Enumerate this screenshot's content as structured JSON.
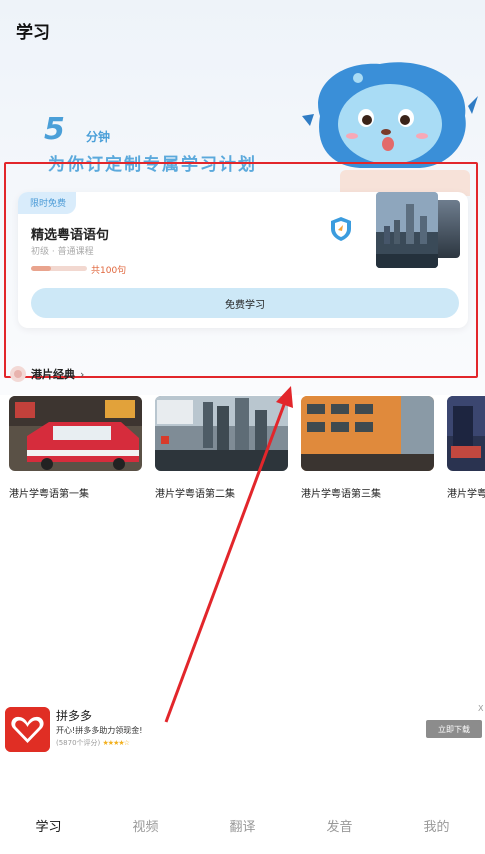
{
  "page": {
    "title": "学习"
  },
  "promo": {
    "number": "5",
    "unit": "分钟",
    "text": "为你订定制专属学习计划"
  },
  "course_card": {
    "badge": "限时免费",
    "title": "精选粤语语句",
    "subtitle": "初级 · 普通课程",
    "progress_fraction": 0.35,
    "count_label": "共100句",
    "button_label": "免费学习"
  },
  "section": {
    "title": "港片经典",
    "arrow": "›"
  },
  "videos": [
    {
      "label": "港片学粤语第一集"
    },
    {
      "label": "港片学粤语第二集"
    },
    {
      "label": "港片学粤语第三集"
    },
    {
      "label": "港片学粤"
    }
  ],
  "ad": {
    "name": "拼多多",
    "desc": "开心!拼多多助力领现金!",
    "rating_text": "(5870个评分)",
    "stars": "★★★★☆",
    "button_label": "立即下载",
    "close_label": "X"
  },
  "bottom_nav": [
    {
      "label": "学习",
      "active": true
    },
    {
      "label": "视频",
      "active": false
    },
    {
      "label": "翻译",
      "active": false
    },
    {
      "label": "发音",
      "active": false
    },
    {
      "label": "我的",
      "active": false
    }
  ],
  "colors": {
    "accent_blue": "#4a9fd8",
    "highlight_red": "#e2262b",
    "button_blue": "#cde8f7",
    "ad_brand": "#e02e24"
  }
}
